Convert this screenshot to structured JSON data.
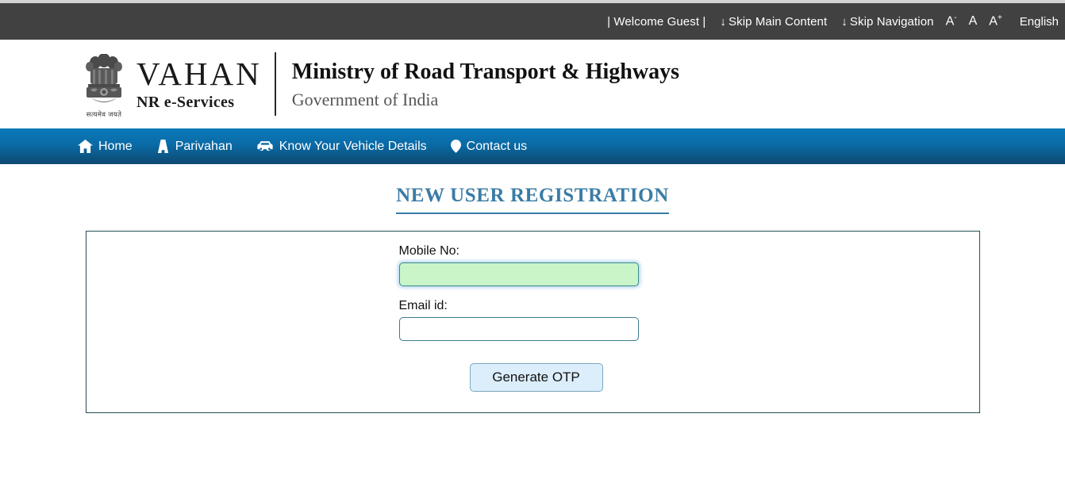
{
  "utility_bar": {
    "welcome": "| Welcome Guest |",
    "skip_main": "Skip Main Content",
    "skip_nav": "Skip Navigation",
    "arrow_glyph": "↓",
    "font_decrease": "A",
    "font_decrease_sup": "-",
    "font_normal": "A",
    "font_increase": "A",
    "font_increase_sup": "+",
    "language": "English",
    "bg_color": "#414141"
  },
  "brand": {
    "logo_main": "VAHAN",
    "logo_sub": "NR e-Services",
    "emblem_motto": "सत्यमेव जयते",
    "ministry_title": "Ministry of Road Transport & Highways",
    "ministry_sub": "Government of India"
  },
  "nav": {
    "accent_color": "#0a6ba6",
    "items": [
      {
        "label": "Home",
        "icon": "home-icon"
      },
      {
        "label": "Parivahan",
        "icon": "road-icon"
      },
      {
        "label": "Know Your Vehicle Details",
        "icon": "car-icon"
      },
      {
        "label": "Contact us",
        "icon": "map-pin-icon"
      }
    ]
  },
  "main": {
    "page_title": "NEW USER REGISTRATION",
    "title_color": "#3a7ca5",
    "form": {
      "mobile_label": "Mobile No:",
      "mobile_value": "",
      "mobile_placeholder": "",
      "mobile_focused_bg": "#c9f5c9",
      "email_label": "Email id:",
      "email_value": "",
      "email_placeholder": "",
      "submit_label": "Generate OTP"
    }
  }
}
